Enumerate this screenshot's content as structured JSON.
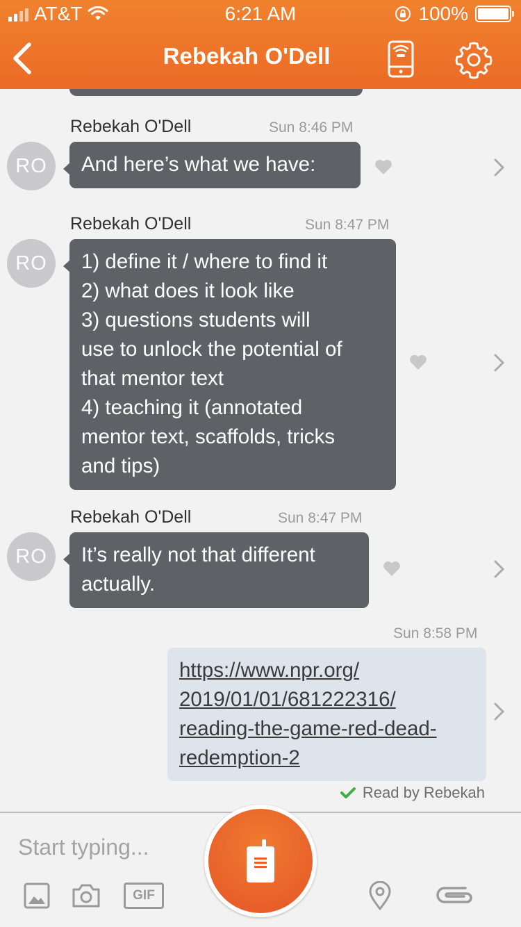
{
  "status_bar": {
    "carrier": "AT&T",
    "time": "6:21 AM",
    "battery": "100%"
  },
  "nav": {
    "title": "Rebekah O'Dell",
    "back_icon": "chevron-left-icon",
    "walkie_icon": "walkie-talkie-phone-icon",
    "settings_icon": "gear-icon"
  },
  "messages": [
    {
      "sender": "Rebekah O'Dell",
      "time": "Sun 8:46 PM",
      "avatar": "RO",
      "lines": [
        "And here’s what we have:"
      ]
    },
    {
      "sender": "Rebekah O'Dell",
      "time": "Sun 8:47 PM",
      "avatar": "RO",
      "lines": [
        "1) define it / where to find it",
        "2) what does it look like",
        "3) questions students will",
        "use to unlock the potential of",
        "that mentor text",
        "4)  teaching it (annotated",
        "mentor text, scaffolds, tricks",
        "and tips)"
      ]
    },
    {
      "sender": "Rebekah O'Dell",
      "time": "Sun 8:47 PM",
      "avatar": "RO",
      "lines": [
        "It’s really not that different",
        "actually."
      ]
    }
  ],
  "outgoing": {
    "time": "Sun 8:58 PM",
    "link_lines": [
      "https://www.npr.org/",
      "2019/01/01/681222316/",
      "reading-the-game-red-dead-",
      "redemption-2"
    ],
    "read_receipt": "Read by Rebekah"
  },
  "composer": {
    "placeholder": "Start typing...",
    "gif_label": "GIF",
    "icons": [
      "image-icon",
      "camera-icon",
      "gif-icon",
      "push-to-talk-icon",
      "location-pin-icon",
      "paperclip-icon"
    ]
  },
  "colors": {
    "brand_orange": "#ec6a26",
    "incoming_bubble": "#5e6166",
    "outgoing_bubble": "#dde4ec",
    "read_check": "#3fae49"
  }
}
